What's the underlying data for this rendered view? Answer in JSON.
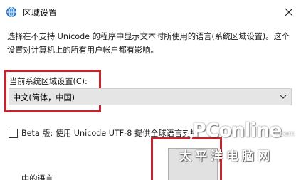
{
  "window": {
    "title": "区域设置",
    "title_icon": "region-globe-icon",
    "close_icon": "close-icon"
  },
  "description": "选择在不支持 Unicode 的程序中显示文本时所使用的语言(系统区域设置)。这个设置对计算机上的所有用户帐户都有影响。",
  "locale": {
    "label": "当前系统区域设置(C):",
    "selected": "中文(简体，中国)"
  },
  "beta": {
    "label": "Beta 版: 使用 Unicode UTF-8 提供全球语言支持",
    "checked": false
  },
  "clipped_label": "中的语言",
  "watermark": {
    "brand": "PConline",
    "com": ".com",
    "chinese": "太平洋电脑网"
  },
  "colors": {
    "highlight": "#c8232c",
    "select_bg": "#e5e5e5"
  }
}
